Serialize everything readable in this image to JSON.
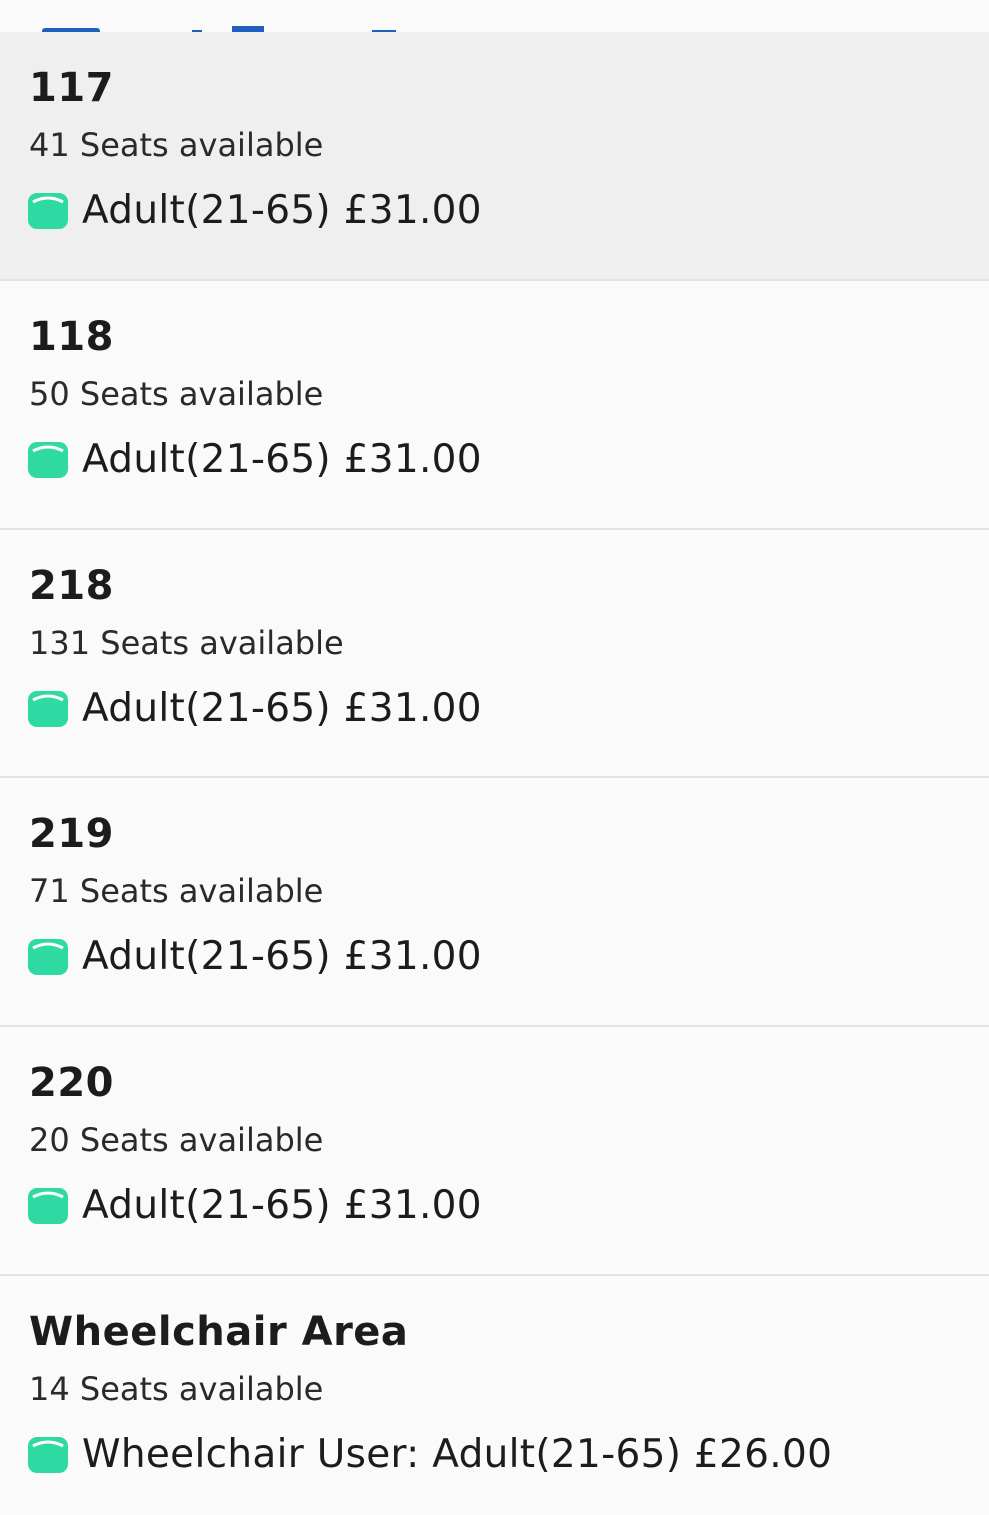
{
  "colors": {
    "seat_icon": "#2fd9a2",
    "selected_row_background": "#efefef",
    "row_background": "#fafafa",
    "divider": "#e3e3e3"
  },
  "coaches": [
    {
      "name": "117",
      "seats": "41 Seats available",
      "fare": "Adult(21-65) £31.00",
      "selected": true,
      "icon": "seat-icon"
    },
    {
      "name": "118",
      "seats": "50 Seats available",
      "fare": "Adult(21-65) £31.00",
      "selected": false,
      "icon": "seat-icon"
    },
    {
      "name": "218",
      "seats": "131 Seats available",
      "fare": "Adult(21-65) £31.00",
      "selected": false,
      "icon": "seat-icon"
    },
    {
      "name": "219",
      "seats": "71 Seats available",
      "fare": "Adult(21-65) £31.00",
      "selected": false,
      "icon": "seat-icon"
    },
    {
      "name": "220",
      "seats": "20 Seats available",
      "fare": "Adult(21-65) £31.00",
      "selected": false,
      "icon": "seat-icon"
    },
    {
      "name": "Wheelchair Area",
      "seats": "14 Seats available",
      "fare": "Wheelchair User: Adult(21-65) £26.00",
      "selected": false,
      "icon": "seat-icon"
    }
  ]
}
